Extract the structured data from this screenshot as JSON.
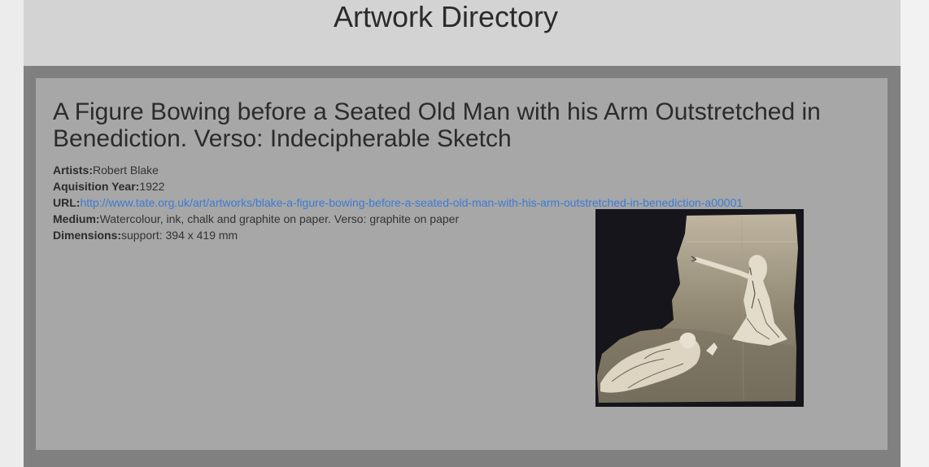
{
  "site": {
    "title": "Artwork Directory"
  },
  "artwork": {
    "title": "A Figure Bowing before a Seated Old Man with his Arm Outstretched in Benediction. Verso: Indecipherable Sketch",
    "artists_label": "Artists:",
    "artists": "Robert Blake",
    "year_label": "Aquisition Year:",
    "year": "1922",
    "url_label": "URL:",
    "url": "http://www.tate.org.uk/art/artworks/blake-a-figure-bowing-before-a-seated-old-man-with-his-arm-outstretched-in-benediction-a00001",
    "medium_label": "Medium:",
    "medium": "Watercolour, ink, chalk and graphite on paper. Verso: graphite on paper",
    "dimensions_label": "Dimensions:",
    "dimensions": "support: 394 x 419 mm"
  }
}
